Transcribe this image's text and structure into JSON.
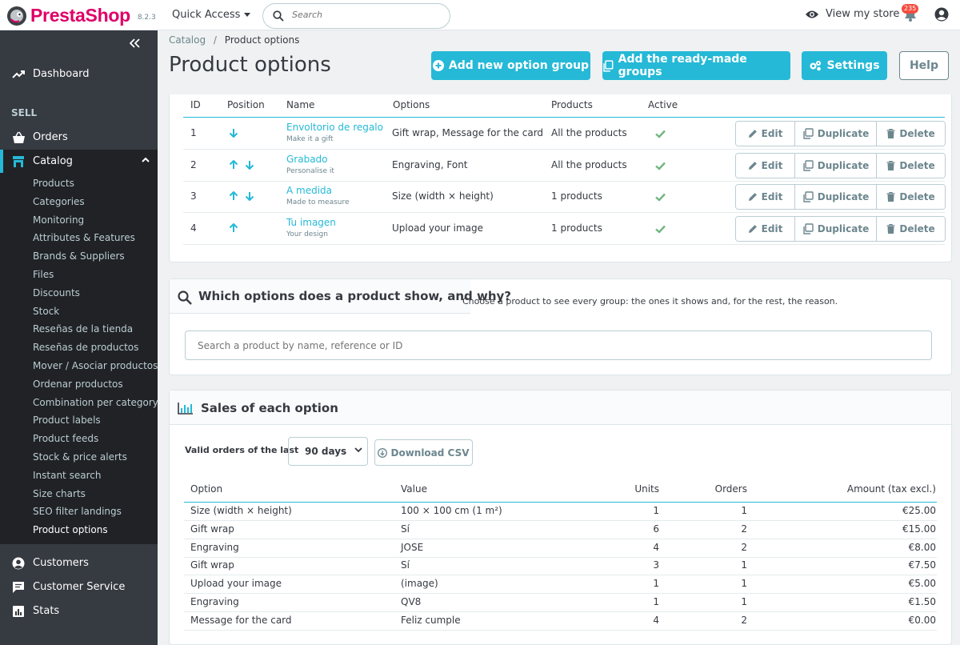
{
  "topbar": {
    "brand": "PrestaShop",
    "version": "8.2.3",
    "quick_access": "Quick Access",
    "search_placeholder": "Search",
    "view_store": "View my store",
    "notifications": "235"
  },
  "sidebar": {
    "dashboard": "Dashboard",
    "section_sell": "SELL",
    "orders": "Orders",
    "catalog": "Catalog",
    "catalog_items": [
      "Products",
      "Categories",
      "Monitoring",
      "Attributes & Features",
      "Brands & Suppliers",
      "Files",
      "Discounts",
      "Stock",
      "Reseñas de la tienda",
      "Reseñas de productos",
      "Mover / Asociar productos",
      "Ordenar productos",
      "Combination per category",
      "Product labels",
      "Product feeds",
      "Stock & price alerts",
      "Instant search",
      "Size charts",
      "SEO filter landings",
      "Product options"
    ],
    "active_item": "Product options",
    "customers": "Customers",
    "customer_service": "Customer Service",
    "stats": "Stats"
  },
  "header": {
    "breadcrumb_parent": "Catalog",
    "breadcrumb_sep": "/",
    "breadcrumb_current": "Product options",
    "title": "Product options",
    "btn_add_group": "Add new option group",
    "btn_ready_made": "Add the ready-made groups",
    "btn_settings": "Settings",
    "btn_help": "Help"
  },
  "groups_table": {
    "columns": [
      "ID",
      "Position",
      "Name",
      "Options",
      "Products",
      "Active"
    ],
    "action_labels": {
      "edit": "Edit",
      "duplicate": "Duplicate",
      "delete": "Delete"
    },
    "rows": [
      {
        "id": "1",
        "position": [
          "down"
        ],
        "name": "Envoltorio de regalo",
        "desc": "Make it a gift",
        "options": "Gift wrap, Message for the card",
        "products": "All the products",
        "active": true
      },
      {
        "id": "2",
        "position": [
          "up",
          "down"
        ],
        "name": "Grabado",
        "desc": "Personalise it",
        "options": "Engraving, Font",
        "products": "All the products",
        "active": true
      },
      {
        "id": "3",
        "position": [
          "up",
          "down"
        ],
        "name": "A medida",
        "desc": "Made to measure",
        "options": "Size (width × height)",
        "products": "1 products",
        "active": true
      },
      {
        "id": "4",
        "position": [
          "up"
        ],
        "name": "Tu imagen",
        "desc": "Your design",
        "options": "Upload your image",
        "products": "1 products",
        "active": true
      }
    ]
  },
  "diagnose": {
    "title": "Which options does a product show, and why?",
    "help": "Choose a product to see every group: the ones it shows and, for the rest, the reason.",
    "placeholder": "Search a product by name, reference or ID"
  },
  "sales": {
    "title": "Sales of each option",
    "period_label": "Valid orders of the last",
    "period_value": "90 days",
    "download": "Download CSV",
    "columns": [
      "Option",
      "Value",
      "Units",
      "Orders",
      "Amount (tax excl.)"
    ],
    "rows": [
      [
        "Size (width × height)",
        "100 × 100 cm (1 m²)",
        "1",
        "1",
        "€25.00"
      ],
      [
        "Gift wrap",
        "Sí",
        "6",
        "2",
        "€15.00"
      ],
      [
        "Engraving",
        "JOSE",
        "4",
        "2",
        "€8.00"
      ],
      [
        "Gift wrap",
        "Sí",
        "3",
        "1",
        "€7.50"
      ],
      [
        "Upload your image",
        "(image)",
        "1",
        "1",
        "€5.00"
      ],
      [
        "Engraving",
        "QV8",
        "1",
        "1",
        "€1.50"
      ],
      [
        "Message for the card",
        "Feliz cumple",
        "4",
        "2",
        "€0.00"
      ]
    ]
  },
  "colors": {
    "accent": "#25b9d7",
    "sidebar": "#363a41",
    "brand": "#df0067",
    "success": "#70b580"
  }
}
